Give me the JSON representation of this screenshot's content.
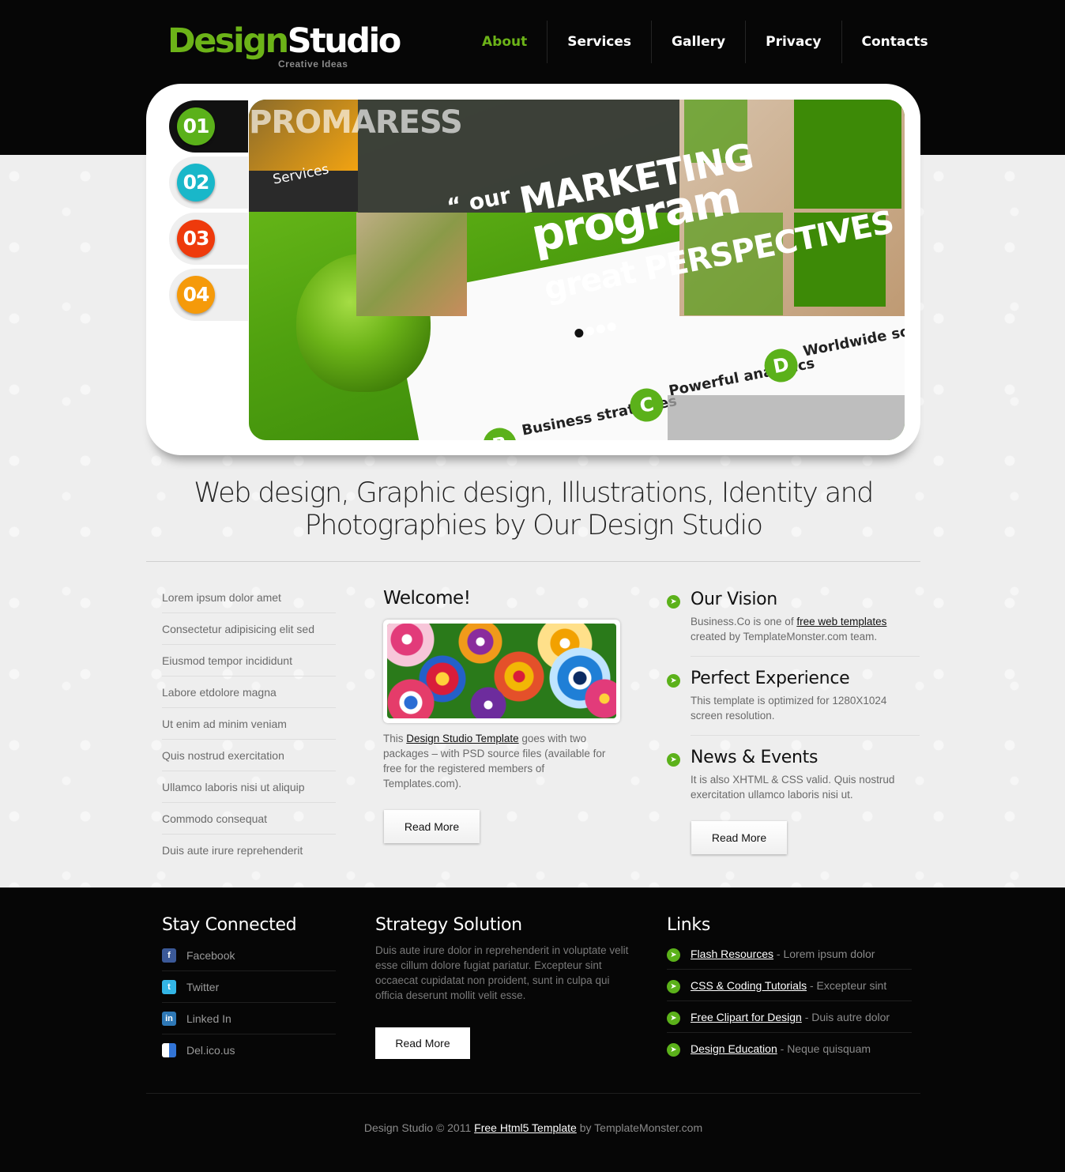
{
  "header": {
    "logo_part1": "Design",
    "logo_part2": "Studio",
    "tagline": "Creative Ideas",
    "nav": [
      "About",
      "Services",
      "Gallery",
      "Privacy",
      "Contacts"
    ],
    "active_nav": "About"
  },
  "slider": {
    "tabs": [
      {
        "label": "01",
        "color": "#5bb11a"
      },
      {
        "label": "02",
        "color": "#19b7c9"
      },
      {
        "label": "03",
        "color": "#ee3a0c"
      },
      {
        "label": "04",
        "color": "#f59a0a"
      }
    ],
    "active_tab": 0,
    "banner": {
      "promo": "PROMARESS",
      "services": "Services",
      "quote_open": "“ our",
      "line1": "MARKETING",
      "line2": "program",
      "line3": "great PERSPECTIVES ”",
      "feature_b_letter": "B",
      "feature_b": "Business strategies",
      "feature_c_letter": "C",
      "feature_c": "Powerful analytics",
      "feature_d_letter": "D",
      "feature_d": "Worldwide solutions"
    },
    "pager_count": 4,
    "pager_active": 0
  },
  "headline": {
    "line1": "Web design, Graphic design, Illustrations, Identity and",
    "line2": "Photographies by Our Design Studio"
  },
  "left_list": [
    "Lorem ipsum dolor amet",
    "Consectetur adipisicing elit sed",
    "Eiusmod tempor incididunt",
    "Labore etdolore magna",
    "Ut enim ad minim veniam",
    "Quis nostrud exercitation",
    "Ullamco laboris nisi ut aliquip",
    "Commodo consequat",
    "Duis aute irure reprehenderit"
  ],
  "welcome": {
    "title": "Welcome!",
    "text_before": "This ",
    "link": "Design Studio Template",
    "text_after": " goes with two packages – with PSD source files (available for free for the registered members of Templates.com).",
    "button": "Read More"
  },
  "right_column": {
    "items": [
      {
        "title": "Our Vision",
        "text_before": "Business.Co is one of ",
        "link": "free web templates",
        "text_after": " created by TemplateMonster.com team."
      },
      {
        "title": "Perfect Experience",
        "text": "This template is optimized for 1280X1024 screen resolution."
      },
      {
        "title": "News & Events",
        "text": "It is also XHTML & CSS valid. Quis nostrud exercitation ullamco laboris nisi ut."
      }
    ],
    "button": "Read More"
  },
  "footer": {
    "stay_connected": {
      "title": "Stay Connected",
      "items": [
        {
          "label": "Facebook",
          "icon": "facebook-icon",
          "glyph": "f",
          "color": "#3b5998"
        },
        {
          "label": "Twitter",
          "icon": "twitter-icon",
          "glyph": "t",
          "color": "#33b5e5"
        },
        {
          "label": "Linked In",
          "icon": "linkedin-icon",
          "glyph": "in",
          "color": "#2e78b6"
        },
        {
          "label": "Del.ico.us",
          "icon": "delicious-icon",
          "glyph": "",
          "color": "#3274d6"
        }
      ]
    },
    "strategy": {
      "title": "Strategy Solution",
      "text": "Duis aute irure dolor in reprehenderit in voluptate velit esse cillum dolore fugiat pariatur. Excepteur sint occaecat cupidatat non proident, sunt in culpa qui officia deserunt mollit velit esse.",
      "button": "Read More"
    },
    "links": {
      "title": "Links",
      "items": [
        {
          "link": "Flash Resources",
          "desc": " - Lorem ipsum dolor"
        },
        {
          "link": "CSS & Coding Tutorials",
          "desc": " - Excepteur sint"
        },
        {
          "link": "Free Clipart for Design",
          "desc": " - Duis autre dolor"
        },
        {
          "link": "Design Education",
          "desc": " - Neque quisquam"
        }
      ]
    },
    "copyright_before": "Design Studio © 2011 ",
    "copyright_link": "Free Html5 Template",
    "copyright_after": " by TemplateMonster.com"
  },
  "colors": {
    "accent": "#6cb318",
    "dark": "#060606",
    "light_bg": "#efefef"
  }
}
